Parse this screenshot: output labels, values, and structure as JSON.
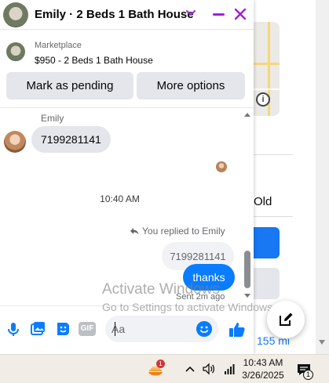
{
  "chat": {
    "title": "Emily · 2 Beds 1 Bath House",
    "listing": {
      "label": "Marketplace",
      "title": "$950 - 2 Beds 1 Bath House"
    },
    "actions": {
      "pending": "Mark as pending",
      "more": "More options"
    },
    "messages": {
      "sender_name": "Emily",
      "incoming_text": "7199281141",
      "timestamp": "10:40 AM",
      "reply_note": "You replied to Emily",
      "quoted_text": "7199281141",
      "outgoing_text": "thanks",
      "sent_note": "Sent 2m ago"
    },
    "composer": {
      "placeholder": "Aa",
      "gif_label": "GIF"
    }
  },
  "background": {
    "partial_text": "Old",
    "distance_text": "155 mi"
  },
  "watermark": {
    "line1": "Activate Windows",
    "line2": "Go to Settings to activate Windows."
  },
  "taskbar": {
    "time": "10:43 AM",
    "date": "3/26/2025",
    "app_badge": "1",
    "notification_badge": "1"
  },
  "colors": {
    "accent_purple": "#a01fd6",
    "messenger_blue": "#0a7cff",
    "bubble_gray": "#e4e6eb"
  }
}
